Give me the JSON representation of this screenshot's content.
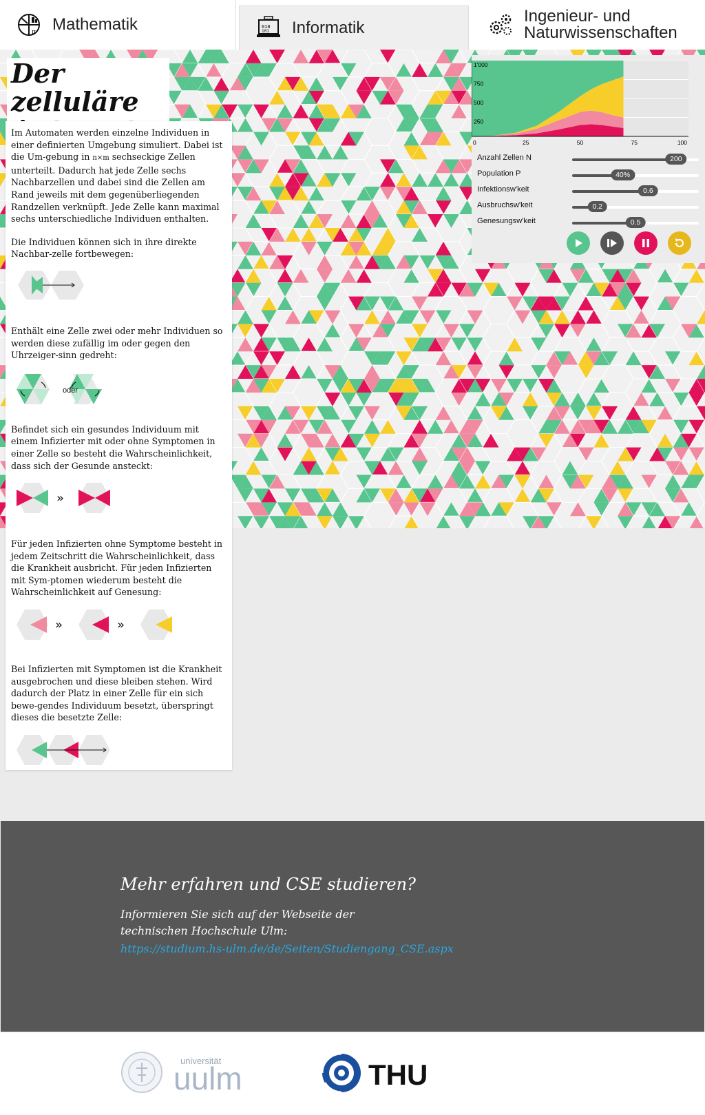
{
  "nav": {
    "tabs": [
      {
        "label": "Mathematik",
        "icon": "math-icon"
      },
      {
        "label": "Informatik",
        "icon": "computer-icon",
        "active": true
      },
      {
        "label_line1": "Ingenieur- und",
        "label_line2": "Naturwissenschaften",
        "icon": "gears-icon"
      }
    ]
  },
  "title": {
    "line1": "Der zelluläre",
    "line2": "Automat"
  },
  "intro": {
    "p1_a": "Im Automaten werden einzelne Individuen in einer definierten Umgebung simuliert. Dabei ist die Um-gebung in ",
    "p1_nxm": "n×m",
    "p1_b": " sechseckige Zellen unterteilt. Dadurch hat jede Zelle sechs Nachbarzellen und dabei sind die Zellen am Rand jeweils mit dem gegenüberliegenden Randzellen verknüpft. Jede Zelle kann maximal sechs unterschiedliche Individuen enthalten.",
    "p2": "Die Individuen können sich in ihre direkte Nachbar-zelle fortbewegen:",
    "p3": "Enthält eine Zelle zwei oder mehr Individuen so werden diese zufällig im oder gegen den Uhrzeiger-sinn gedreht:",
    "oder": "oder",
    "p4": "Befindet sich ein gesundes Individuum mit einem Infizierter mit oder ohne Symptomen in einer Zelle so besteht die Wahrscheinlichkeit, dass sich der Gesunde ansteckt:",
    "p5": "Für jeden Infizierten ohne Symptome besteht in jedem Zeitschritt die Wahrscheinlichkeit, dass die Krankheit ausbricht. Für jeden Infizierten mit Sym-ptomen wiederum besteht die Wahrscheinlichkeit auf Genesung:",
    "p6": "Bei Infizierten mit Symptomen ist die Krankheit ausgebrochen und diese bleiben stehen. Wird dadurch der Platz in einer Zelle für ein sich bewe-gendes Individuum besetzt, überspringt dieses die besetzte Zelle:"
  },
  "colors": {
    "healthy": "#57c58d",
    "infected_asymptomatic": "#f18aa0",
    "infected_symptomatic": "#e2125a",
    "recovered": "#f7cd2a",
    "empty": "#ececec",
    "play": "#57c58d",
    "step": "#555555",
    "pause": "#e2125a",
    "reset": "#e7b81d"
  },
  "chart_data": {
    "type": "area",
    "x_ticks": [
      "0",
      "25",
      "50",
      "75",
      "100"
    ],
    "y_ticks": [
      "250",
      "500",
      "750",
      "1'000"
    ],
    "xlim": [
      0,
      100
    ],
    "ylim": [
      0,
      1000
    ],
    "x": [
      0,
      10,
      20,
      30,
      40,
      50,
      55,
      60,
      65,
      70
    ],
    "series": [
      {
        "color": "#e2125a",
        "values": [
          0,
          5,
          15,
          40,
          90,
          150,
          160,
          150,
          130,
          110
        ]
      },
      {
        "color": "#f18aa0",
        "values": [
          0,
          5,
          20,
          60,
          120,
          170,
          180,
          170,
          150,
          140
        ]
      },
      {
        "color": "#f7cd2a",
        "values": [
          0,
          0,
          10,
          40,
          110,
          210,
          280,
          370,
          460,
          540
        ]
      },
      {
        "color": "#57c58d",
        "values": [
          1000,
          990,
          955,
          860,
          680,
          470,
          380,
          310,
          260,
          210
        ]
      }
    ]
  },
  "controls": [
    {
      "label": "Anzahl Zellen N",
      "value": "200",
      "fraction": 0.82
    },
    {
      "label": "Population P",
      "value": "40%",
      "fraction": 0.4
    },
    {
      "label": "Infektionsw'keit",
      "value": "0.6",
      "fraction": 0.6
    },
    {
      "label": "Ausbruchsw'keit",
      "value": "0.2",
      "fraction": 0.2
    },
    {
      "label": "Genesungsw'keit",
      "value": "0.5",
      "fraction": 0.5
    }
  ],
  "buttons": [
    "play-icon",
    "step-icon",
    "pause-icon",
    "reset-icon"
  ],
  "promo": {
    "heading": "Mehr erfahren und CSE studieren?",
    "sub": "Informieren Sie sich auf der Webseite der technischen Hochschule Ulm:",
    "link": "https://studium.hs-ulm.de/de/Seiten/Studiengang_CSE.aspx"
  },
  "logos": {
    "uulm_top": "universität",
    "uulm_bottom": "uulm",
    "seal_text": "UNIVERSITÄT ULM · SCIENDO · DOCENDO · CURANDO ·",
    "thu": "THU"
  }
}
